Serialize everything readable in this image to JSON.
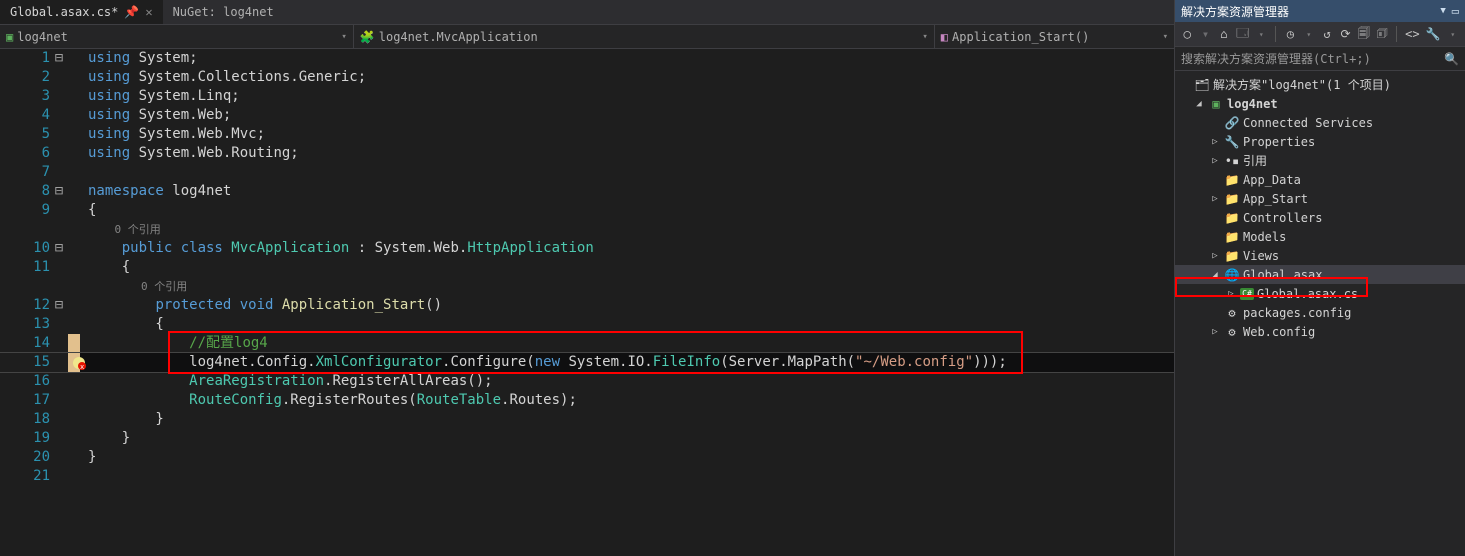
{
  "tabs": [
    {
      "label": "Global.asax.cs*",
      "active": true
    },
    {
      "label": "NuGet: log4net",
      "active": false
    }
  ],
  "nav": {
    "scope": "log4net",
    "class": "log4net.MvcApplication",
    "member": "Application_Start()"
  },
  "code": {
    "lines": [
      {
        "n": 1,
        "fold": "⊟",
        "seg": [
          {
            "t": "using ",
            "c": "kw-using"
          },
          {
            "t": "System;",
            "c": "white"
          }
        ]
      },
      {
        "n": 2,
        "seg": [
          {
            "t": "using ",
            "c": "kw-using"
          },
          {
            "t": "System.Collections.Generic;",
            "c": "white"
          }
        ]
      },
      {
        "n": 3,
        "seg": [
          {
            "t": "using ",
            "c": "kw-using"
          },
          {
            "t": "System.Linq;",
            "c": "white"
          }
        ]
      },
      {
        "n": 4,
        "seg": [
          {
            "t": "using ",
            "c": "kw-using"
          },
          {
            "t": "System.Web;",
            "c": "white"
          }
        ]
      },
      {
        "n": 5,
        "seg": [
          {
            "t": "using ",
            "c": "kw-using"
          },
          {
            "t": "System.Web.Mvc;",
            "c": "white"
          }
        ]
      },
      {
        "n": 6,
        "seg": [
          {
            "t": "using ",
            "c": "kw-using"
          },
          {
            "t": "System.Web.Routing;",
            "c": "white"
          }
        ]
      },
      {
        "n": 7,
        "seg": []
      },
      {
        "n": 8,
        "fold": "⊟",
        "seg": [
          {
            "t": "namespace ",
            "c": "kw-ns"
          },
          {
            "t": "log4net",
            "c": "white"
          }
        ]
      },
      {
        "n": 9,
        "seg": [
          {
            "t": "{",
            "c": "punct"
          }
        ]
      },
      {
        "n": 0,
        "codelens": true,
        "seg": [
          {
            "t": "    0 个引用",
            "c": "codelens"
          }
        ]
      },
      {
        "n": 10,
        "fold": "⊟",
        "seg": [
          {
            "t": "    ",
            "c": ""
          },
          {
            "t": "public class ",
            "c": "kw-pub"
          },
          {
            "t": "MvcApplication",
            "c": "type"
          },
          {
            "t": " : System.Web.",
            "c": "white"
          },
          {
            "t": "HttpApplication",
            "c": "type"
          }
        ]
      },
      {
        "n": 11,
        "seg": [
          {
            "t": "    {",
            "c": "punct"
          }
        ]
      },
      {
        "n": 0,
        "codelens": true,
        "seg": [
          {
            "t": "        0 个引用",
            "c": "codelens"
          }
        ]
      },
      {
        "n": 12,
        "fold": "⊟",
        "seg": [
          {
            "t": "        ",
            "c": ""
          },
          {
            "t": "protected void ",
            "c": "kw-prot"
          },
          {
            "t": "Application_Start",
            "c": "method"
          },
          {
            "t": "()",
            "c": "white"
          }
        ]
      },
      {
        "n": 13,
        "seg": [
          {
            "t": "        {",
            "c": "punct"
          }
        ]
      },
      {
        "n": 14,
        "mod": true,
        "seg": [
          {
            "t": "            ",
            "c": ""
          },
          {
            "t": "//配置log4",
            "c": "comment"
          }
        ]
      },
      {
        "n": 15,
        "mod": true,
        "err": true,
        "cur": true,
        "seg": [
          {
            "t": "            log4net.Config.",
            "c": "white"
          },
          {
            "t": "XmlConfigurator",
            "c": "type"
          },
          {
            "t": ".Configure(",
            "c": "white"
          },
          {
            "t": "new ",
            "c": "kw-new"
          },
          {
            "t": "System.IO.",
            "c": "white"
          },
          {
            "t": "FileInfo",
            "c": "type"
          },
          {
            "t": "(Server.MapPath(",
            "c": "white"
          },
          {
            "t": "\"~/Web.config\"",
            "c": "str"
          },
          {
            "t": ")));",
            "c": "white"
          }
        ]
      },
      {
        "n": 16,
        "seg": [
          {
            "t": "            ",
            "c": ""
          },
          {
            "t": "AreaRegistration",
            "c": "type"
          },
          {
            "t": ".RegisterAllAreas();",
            "c": "white"
          }
        ]
      },
      {
        "n": 17,
        "seg": [
          {
            "t": "            ",
            "c": ""
          },
          {
            "t": "RouteConfig",
            "c": "type"
          },
          {
            "t": ".RegisterRoutes(",
            "c": "white"
          },
          {
            "t": "RouteTable",
            "c": "type"
          },
          {
            "t": ".Routes);",
            "c": "white"
          }
        ]
      },
      {
        "n": 18,
        "seg": [
          {
            "t": "        }",
            "c": "punct"
          }
        ]
      },
      {
        "n": 19,
        "seg": [
          {
            "t": "    }",
            "c": "punct"
          }
        ]
      },
      {
        "n": 20,
        "seg": [
          {
            "t": "}",
            "c": "punct"
          }
        ]
      },
      {
        "n": 21,
        "seg": []
      }
    ]
  },
  "solutionExplorer": {
    "title": "解决方案资源管理器",
    "searchPlaceholder": "搜索解决方案资源管理器(Ctrl+;)",
    "solutionLabel": "解决方案\"log4net\"(1 个项目)",
    "project": "log4net",
    "nodes": [
      {
        "label": "Connected Services",
        "icon": "link",
        "exp": ""
      },
      {
        "label": "Properties",
        "icon": "wrench",
        "exp": "▷"
      },
      {
        "label": "引用",
        "icon": "refs",
        "exp": "▷"
      },
      {
        "label": "App_Data",
        "icon": "folder",
        "exp": ""
      },
      {
        "label": "App_Start",
        "icon": "folder",
        "exp": "▷"
      },
      {
        "label": "Controllers",
        "icon": "folder",
        "exp": ""
      },
      {
        "label": "Models",
        "icon": "folder",
        "exp": ""
      },
      {
        "label": "Views",
        "icon": "folder",
        "exp": "▷"
      },
      {
        "label": "Global.asax",
        "icon": "file",
        "exp": "◢",
        "sel": true
      },
      {
        "label": "Global.asax.cs",
        "icon": "cs",
        "exp": "▷",
        "indent": 3
      },
      {
        "label": "packages.config",
        "icon": "cfg",
        "exp": ""
      },
      {
        "label": "Web.config",
        "icon": "cfg",
        "exp": "▷"
      }
    ]
  }
}
